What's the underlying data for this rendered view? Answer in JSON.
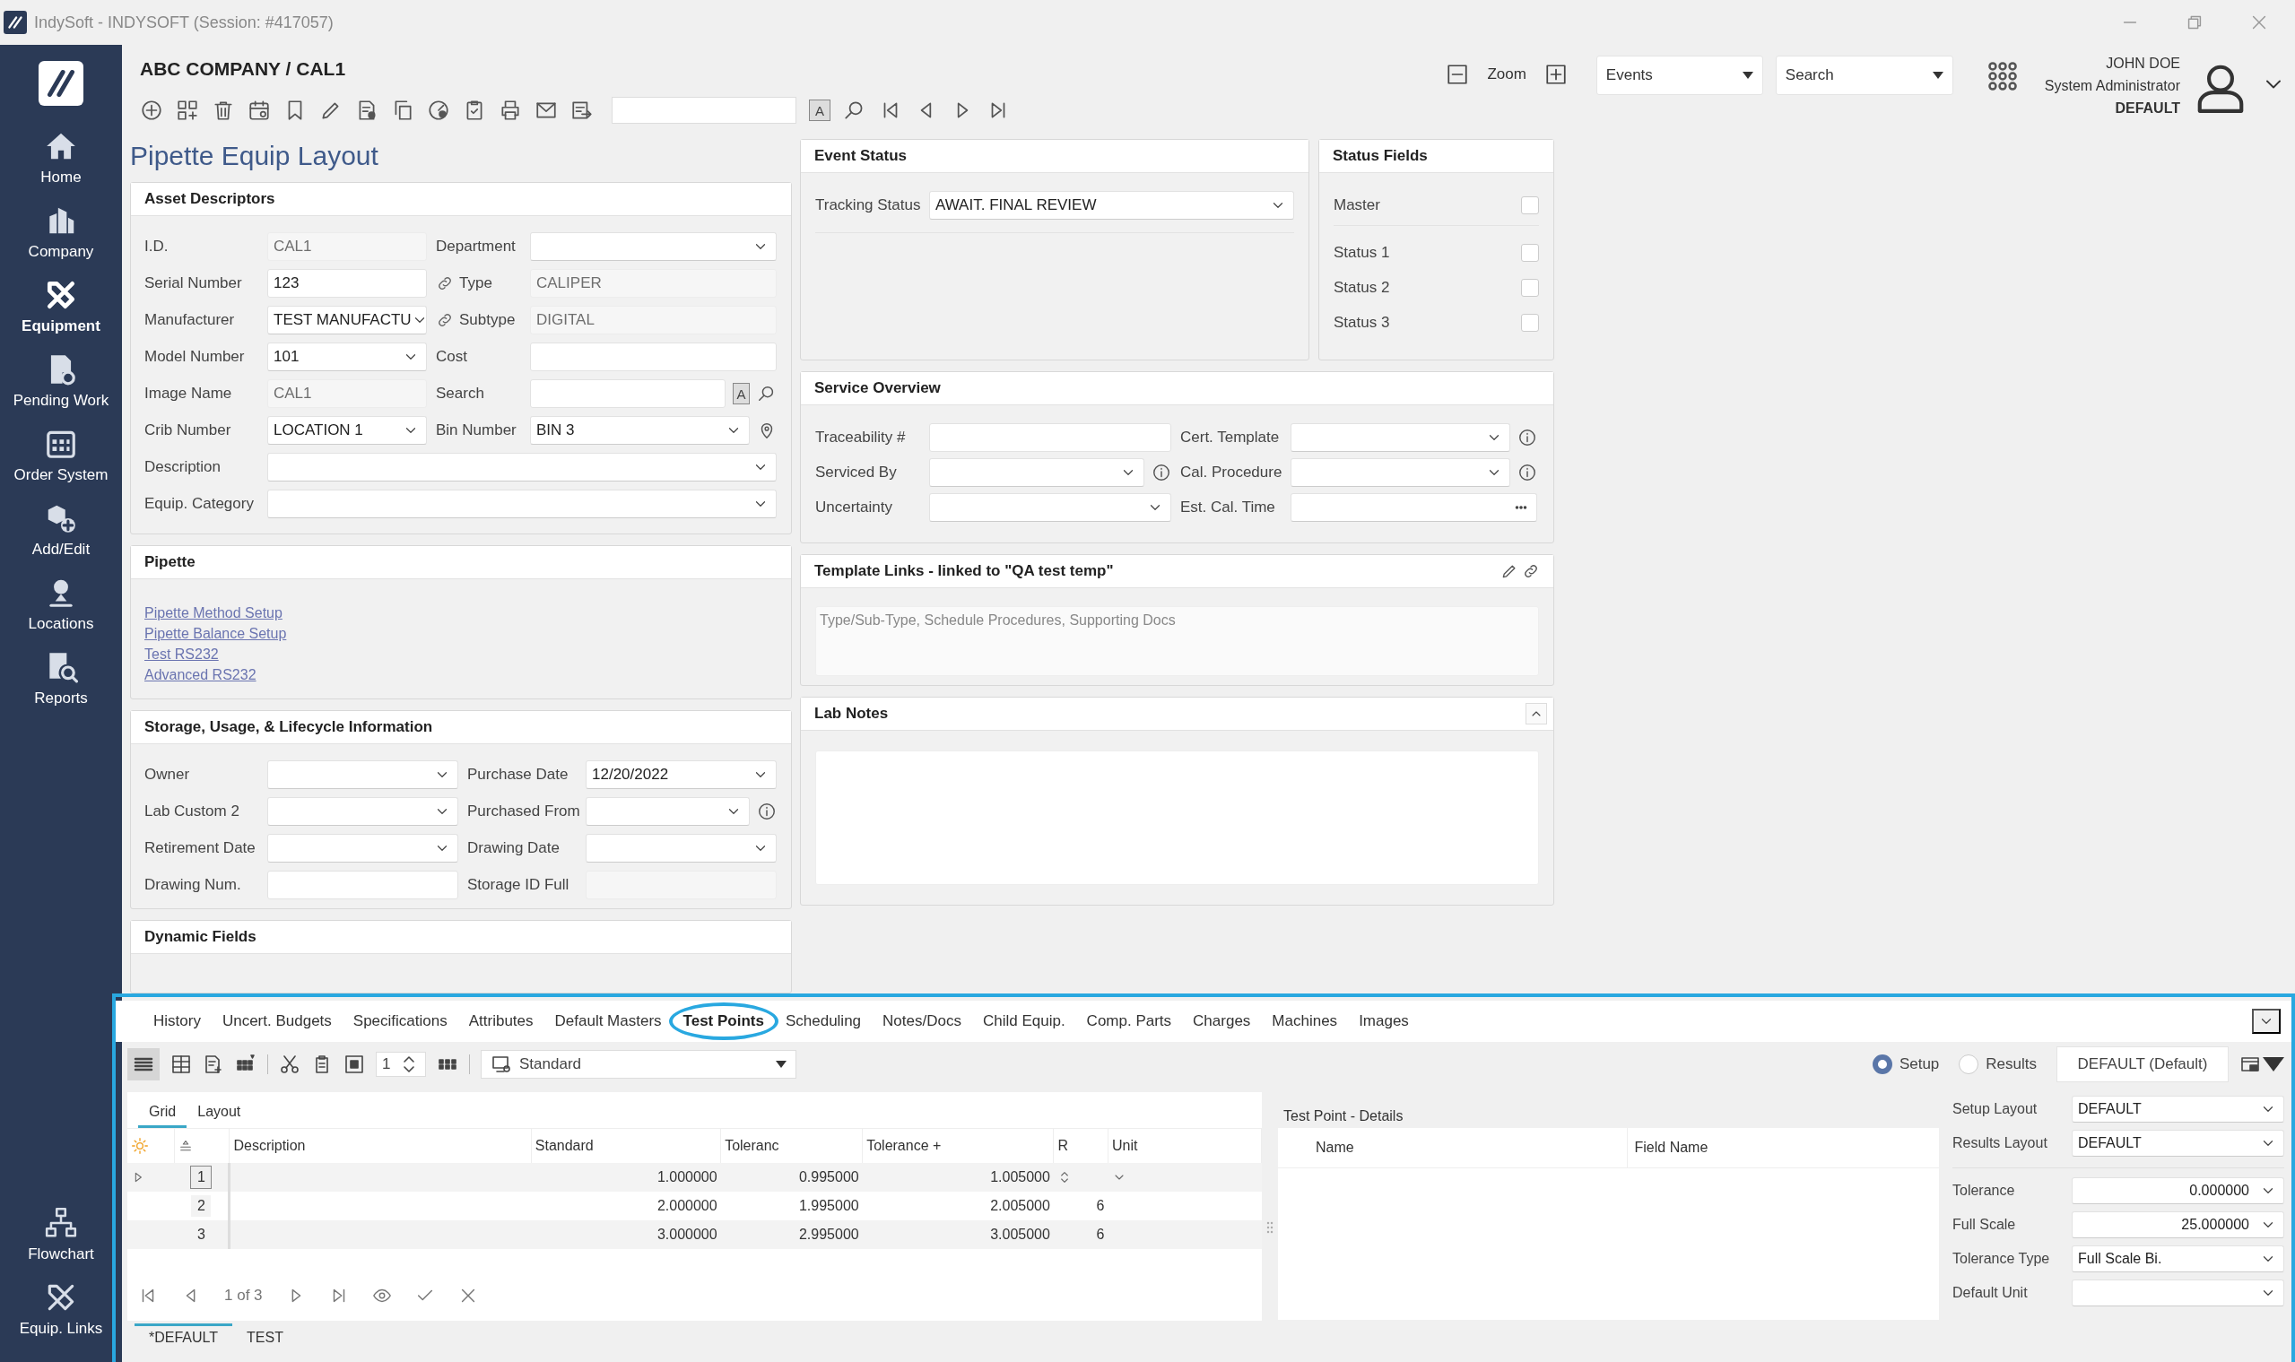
{
  "window": {
    "title": "IndySoft - INDYSOFT (Session: #417057)"
  },
  "sidebar": {
    "items": [
      {
        "label": "Home",
        "selected": false
      },
      {
        "label": "Company",
        "selected": false
      },
      {
        "label": "Equipment",
        "selected": true
      },
      {
        "label": "Pending Work",
        "selected": false
      },
      {
        "label": "Order System",
        "selected": false
      },
      {
        "label": "Add/Edit",
        "selected": false
      },
      {
        "label": "Locations",
        "selected": false
      },
      {
        "label": "Reports",
        "selected": false
      }
    ],
    "bottom_items": [
      {
        "label": "Flowchart",
        "selected": false
      },
      {
        "label": "Equip. Links",
        "selected": false
      }
    ]
  },
  "header": {
    "breadcrumb": "ABC COMPANY / CAL1",
    "match_button": "A",
    "zoom_label": "Zoom",
    "events_dropdown": "Events",
    "search_dropdown": "Search",
    "user": {
      "name": "JOHN DOE",
      "role": "System Administrator",
      "profile": "DEFAULT"
    }
  },
  "page_title": "Pipette Equip Layout",
  "asset_descriptors": {
    "title": "Asset Descriptors",
    "rows": [
      [
        {
          "label": "I.D.",
          "value": "CAL1",
          "kind": "readonly",
          "linked": false
        },
        {
          "label": "Department",
          "kind": "dropdown",
          "linked": false
        }
      ],
      [
        {
          "label": "Serial Number",
          "value": "123",
          "kind": "text",
          "linked": false
        },
        {
          "label": "Type",
          "value": "CALIPER",
          "kind": "readonly",
          "linked": true
        }
      ],
      [
        {
          "label": "Manufacturer",
          "value": "TEST MANUFACTU",
          "kind": "dropdown",
          "linked": false
        },
        {
          "label": "Subtype",
          "value": "DIGITAL",
          "kind": "readonly",
          "linked": true
        }
      ],
      [
        {
          "label": "Model Number",
          "value": "101",
          "kind": "dropdown",
          "linked": false
        },
        {
          "label": "Cost",
          "kind": "text",
          "linked": false
        }
      ],
      [
        {
          "label": "Image Name",
          "value": "CAL1",
          "kind": "readonly",
          "linked": false
        },
        {
          "label": "Search",
          "kind": "search",
          "button_label": "A",
          "linked": false
        }
      ],
      [
        {
          "label": "Crib Number",
          "value": "LOCATION 1",
          "kind": "dropdown",
          "linked": false
        },
        {
          "label": "Bin Number",
          "value": "BIN 3",
          "kind": "dropdown-pin",
          "linked": false
        }
      ],
      [
        {
          "label": "Description",
          "kind": "dropdown",
          "linked": false
        }
      ],
      [
        {
          "label": "Equip. Category",
          "kind": "dropdown",
          "linked": false
        }
      ]
    ]
  },
  "pipette": {
    "title": "Pipette",
    "links": [
      "Pipette Method Setup",
      "Pipette Balance Setup",
      "Test RS232",
      "Advanced RS232"
    ]
  },
  "storage": {
    "title": "Storage, Usage, & Lifecycle Information",
    "rows": [
      [
        {
          "label": "Owner",
          "kind": "dropdown"
        },
        {
          "label": "Purchase Date",
          "value": "12/20/2022",
          "kind": "dropdown"
        }
      ],
      [
        {
          "label": "Lab Custom 2",
          "kind": "dropdown"
        },
        {
          "label": "Purchased From",
          "kind": "dropdown-info"
        }
      ],
      [
        {
          "label": "Retirement Date",
          "kind": "dropdown"
        },
        {
          "label": "Drawing Date",
          "kind": "dropdown"
        }
      ],
      [
        {
          "label": "Drawing Num.",
          "kind": "text"
        },
        {
          "label": "Storage ID Full",
          "kind": "readonly"
        }
      ]
    ]
  },
  "dynamic_fields": {
    "title": "Dynamic Fields"
  },
  "event_status": {
    "title": "Event Status",
    "fields": [
      {
        "label": "Tracking Status",
        "value": "AWAIT. FINAL REVIEW",
        "kind": "dropdown"
      }
    ]
  },
  "status_fields": {
    "title": "Status Fields",
    "items": [
      {
        "label": "Master",
        "checked": false
      },
      {
        "label": "Status 1",
        "checked": false
      },
      {
        "label": "Status 2",
        "checked": false
      },
      {
        "label": "Status 3",
        "checked": false
      }
    ]
  },
  "service_overview": {
    "title": "Service Overview",
    "rows": [
      [
        {
          "label": "Traceability #",
          "kind": "text"
        },
        {
          "label": "Cert. Template",
          "kind": "dropdown-info"
        }
      ],
      [
        {
          "label": "Serviced By",
          "kind": "dropdown-info"
        },
        {
          "label": "Cal. Procedure",
          "kind": "dropdown-info"
        }
      ],
      [
        {
          "label": "Uncertainty",
          "kind": "dropdown"
        },
        {
          "label": "Est. Cal. Time",
          "kind": "ellipsis"
        }
      ]
    ]
  },
  "template_links": {
    "title": "Template Links - linked to \"QA test temp\"",
    "placeholder": "Type/Sub-Type, Schedule Procedures, Supporting Docs"
  },
  "lab_notes": {
    "title": "Lab Notes",
    "expanded": true
  },
  "bottom_panel": {
    "tabs": [
      {
        "label": "History",
        "selected": false
      },
      {
        "label": "Uncert. Budgets",
        "selected": false
      },
      {
        "label": "Specifications",
        "selected": false
      },
      {
        "label": "Attributes",
        "selected": false
      },
      {
        "label": "Default Masters",
        "selected": false
      },
      {
        "label": "Test Points",
        "selected": true
      },
      {
        "label": "Scheduling",
        "selected": false
      },
      {
        "label": "Notes/Docs",
        "selected": false
      },
      {
        "label": "Child Equip.",
        "selected": false
      },
      {
        "label": "Comp. Parts",
        "selected": false
      },
      {
        "label": "Charges",
        "selected": false
      },
      {
        "label": "Machines",
        "selected": false
      },
      {
        "label": "Images",
        "selected": false
      }
    ],
    "toolbar": {
      "spin_value": "1",
      "view_dropdown": "Standard"
    },
    "modes": [
      {
        "label": "Setup",
        "selected": true
      },
      {
        "label": "Results",
        "selected": false
      }
    ],
    "layout_select": "DEFAULT (Default)",
    "grid": {
      "subtabs": [
        {
          "label": "Grid",
          "selected": true
        },
        {
          "label": "Layout",
          "selected": false
        }
      ],
      "columns": [
        "Description",
        "Standard",
        "Toleranc",
        "Tolerance +",
        "R",
        "Unit"
      ],
      "rows": [
        {
          "number": "1",
          "selected": true,
          "standard": "1.000000",
          "tolerance": "0.995000",
          "tolerance_plus": "1.005000"
        },
        {
          "number": "2",
          "selected": false,
          "standard": "2.000000",
          "tolerance": "1.995000",
          "tolerance_plus": "2.005000",
          "r": "6"
        },
        {
          "number": "3",
          "selected": false,
          "standard": "3.000000",
          "tolerance": "2.995000",
          "tolerance_plus": "3.005000",
          "r": "6"
        }
      ],
      "pager": "1 of 3",
      "layout_tabs": [
        {
          "label": "*DEFAULT",
          "selected": true
        },
        {
          "label": "TEST",
          "selected": false
        }
      ]
    },
    "details": {
      "title": "Test Point - Details",
      "columns": [
        "Name",
        "Field Name"
      ]
    },
    "properties": {
      "layout_fields": [
        {
          "label": "Setup Layout",
          "value": "DEFAULT",
          "kind": "dropdown"
        },
        {
          "label": "Results Layout",
          "value": "DEFAULT",
          "kind": "dropdown"
        }
      ],
      "value_fields": [
        {
          "label": "Tolerance",
          "value": "0.000000",
          "kind": "number"
        },
        {
          "label": "Full Scale",
          "value": "25.000000",
          "kind": "number"
        },
        {
          "label": "Tolerance Type",
          "value": "Full Scale Bi.",
          "kind": "dropdown"
        },
        {
          "label": "Default Unit",
          "kind": "dropdown"
        }
      ]
    }
  }
}
